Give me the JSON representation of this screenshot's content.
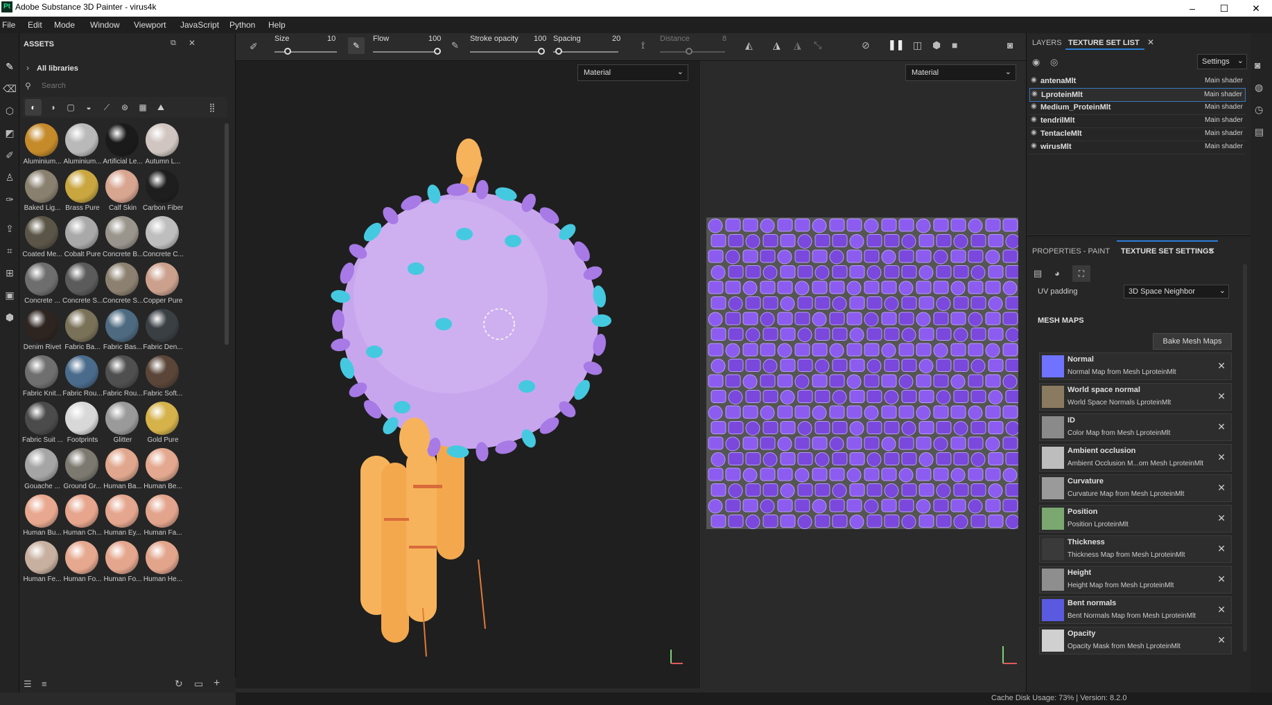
{
  "window": {
    "title": "Adobe Substance 3D Painter - virus4k",
    "logo": "Pt",
    "minimize": "–",
    "maximize": "☐",
    "close": "✕"
  },
  "menu": [
    "File",
    "Edit",
    "Mode",
    "Window",
    "Viewport",
    "JavaScript",
    "Python",
    "Help"
  ],
  "assets": {
    "title": "ASSETS",
    "all_libraries": "All libraries",
    "search_placeholder": "Search",
    "items": [
      {
        "label": "Aluminium...",
        "color": "#c58a2a"
      },
      {
        "label": "Aluminium...",
        "color": "#b9b9b9"
      },
      {
        "label": "Artificial Le...",
        "color": "#1a1a1a"
      },
      {
        "label": "Autumn L...",
        "color": "#d0c5c0"
      },
      {
        "label": "Baked Lig...",
        "color": "#8a8070"
      },
      {
        "label": "Brass Pure",
        "color": "#c9a640"
      },
      {
        "label": "Calf Skin",
        "color": "#d8a590"
      },
      {
        "label": "Carbon Fiber",
        "color": "#1e1e1e"
      },
      {
        "label": "Coated Me...",
        "color": "#5a5546"
      },
      {
        "label": "Cobalt Pure",
        "color": "#a9a9a9"
      },
      {
        "label": "Concrete B...",
        "color": "#9a958c"
      },
      {
        "label": "Concrete C...",
        "color": "#bebebe"
      },
      {
        "label": "Concrete ...",
        "color": "#6e6e6e"
      },
      {
        "label": "Concrete S...",
        "color": "#5b5b5b"
      },
      {
        "label": "Concrete S...",
        "color": "#8c8170"
      },
      {
        "label": "Copper Pure",
        "color": "#cba08d"
      },
      {
        "label": "Denim Rivet",
        "color": "#2e2420"
      },
      {
        "label": "Fabric Ba...",
        "color": "#7a7258"
      },
      {
        "label": "Fabric Bas...",
        "color": "#4d6a80"
      },
      {
        "label": "Fabric Den...",
        "color": "#3a3f44"
      },
      {
        "label": "Fabric Knit...",
        "color": "#6f6f6f"
      },
      {
        "label": "Fabric Rou...",
        "color": "#4a6b8c"
      },
      {
        "label": "Fabric Rou...",
        "color": "#4f4f4f"
      },
      {
        "label": "Fabric Soft...",
        "color": "#5a4538"
      },
      {
        "label": "Fabric Suit ...",
        "color": "#4b4b4b"
      },
      {
        "label": "Footprints",
        "color": "#d8d8d8"
      },
      {
        "label": "Glitter",
        "color": "#9a9a9a"
      },
      {
        "label": "Gold Pure",
        "color": "#d5b24a"
      },
      {
        "label": "Gouache ...",
        "color": "#a5a5a5"
      },
      {
        "label": "Ground Gr...",
        "color": "#7c7a70"
      },
      {
        "label": "Human Ba...",
        "color": "#e0a78e"
      },
      {
        "label": "Human Be...",
        "color": "#e3a88f"
      },
      {
        "label": "Human Bu...",
        "color": "#e8a88f"
      },
      {
        "label": "Human Ch...",
        "color": "#e6a58c"
      },
      {
        "label": "Human Ey...",
        "color": "#e4a68e"
      },
      {
        "label": "Human Fa...",
        "color": "#e2a48c"
      },
      {
        "label": "Human Fe...",
        "color": "#c8b0a0"
      },
      {
        "label": "Human Fo...",
        "color": "#e6a88f"
      },
      {
        "label": "Human Fo...",
        "color": "#e4a68d"
      },
      {
        "label": "Human He...",
        "color": "#e2a58c"
      }
    ]
  },
  "toolbar": {
    "size_label": "Size",
    "size_value": "10",
    "flow_label": "Flow",
    "flow_value": "100",
    "opacity_label": "Stroke opacity",
    "opacity_value": "100",
    "spacing_label": "Spacing",
    "spacing_value": "20",
    "distance_label": "Distance",
    "distance_value": "8"
  },
  "viewport": {
    "left_mode": "Material",
    "right_mode": "Material"
  },
  "layers": {
    "tab1": "LAYERS",
    "tab2": "TEXTURE SET LIST",
    "settings": "Settings",
    "rows": [
      {
        "name": "antenaMlt",
        "shader": "Main shader"
      },
      {
        "name": "LproteinMlt",
        "shader": "Main shader"
      },
      {
        "name": "Medium_ProteinMlt",
        "shader": "Main shader"
      },
      {
        "name": "tendrilMlt",
        "shader": "Main shader"
      },
      {
        "name": "TentacleMlt",
        "shader": "Main shader"
      },
      {
        "name": "wirusMlt",
        "shader": "Main shader"
      }
    ]
  },
  "props": {
    "tab1": "PROPERTIES - PAINT",
    "tab2": "TEXTURE SET SETTINGS",
    "uv_label": "UV padding",
    "uv_value": "3D Space Neighbor",
    "mesh_maps_title": "MESH MAPS",
    "bake_button": "Bake Mesh Maps",
    "maps": [
      {
        "title": "Normal",
        "sub": "Normal Map from Mesh LproteinMlt",
        "color": "#6f73ff"
      },
      {
        "title": "World space normal",
        "sub": "World Space Normals LproteinMlt",
        "color": "#8a7a60"
      },
      {
        "title": "ID",
        "sub": "Color Map from Mesh LproteinMlt",
        "color": "#8a8a8a"
      },
      {
        "title": "Ambient occlusion",
        "sub": "Ambient Occlusion M...om Mesh LproteinMlt",
        "color": "#bdbdbd"
      },
      {
        "title": "Curvature",
        "sub": "Curvature Map from Mesh LproteinMlt",
        "color": "#9a9a9a"
      },
      {
        "title": "Position",
        "sub": "Position LproteinMlt",
        "color": "#7aa870"
      },
      {
        "title": "Thickness",
        "sub": "Thickness Map from Mesh LproteinMlt",
        "color": "#3a3a3a"
      },
      {
        "title": "Height",
        "sub": "Height Map from Mesh LproteinMlt",
        "color": "#8e8e8e"
      },
      {
        "title": "Bent normals",
        "sub": "Bent Normals Map from Mesh LproteinMlt",
        "color": "#5a5ae0"
      },
      {
        "title": "Opacity",
        "sub": "Opacity Mask from Mesh LproteinMlt",
        "color": "#d0d0d0"
      }
    ]
  },
  "status": {
    "text": "Cache Disk Usage:   73% | Version: 8.2.0"
  }
}
